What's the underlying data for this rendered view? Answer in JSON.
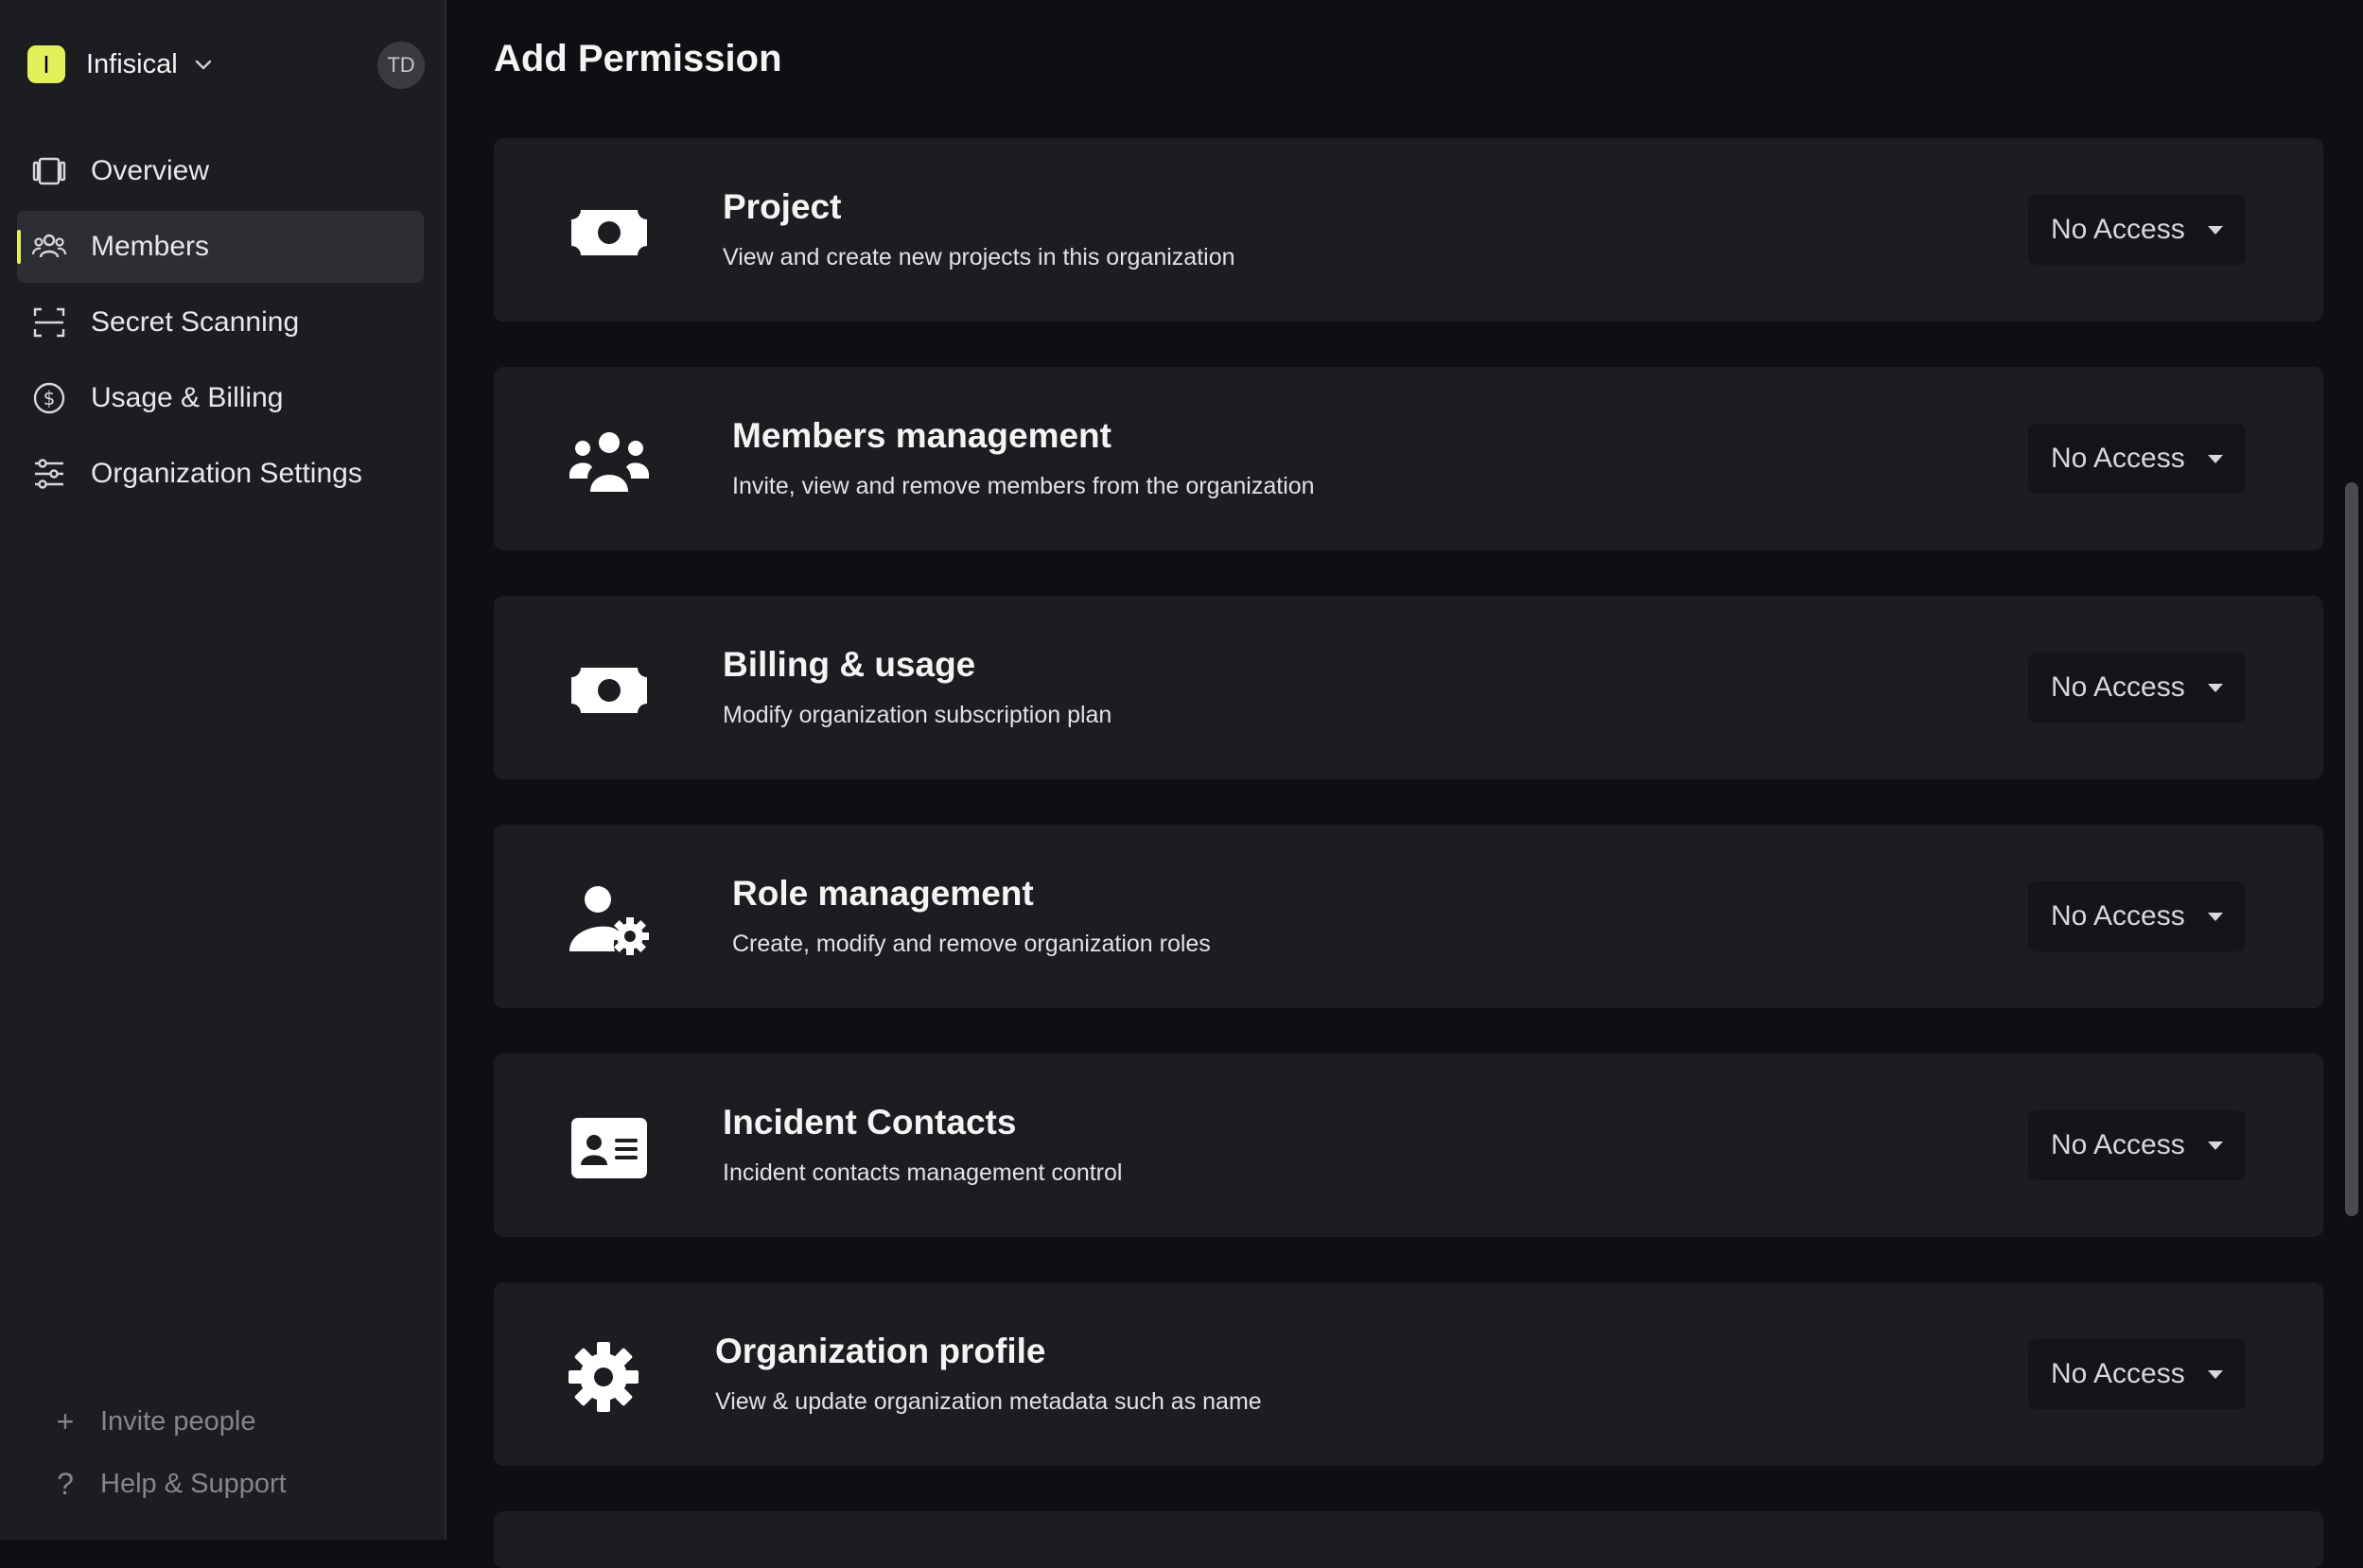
{
  "org": {
    "initial": "I",
    "name": "Infisical",
    "user_initials": "TD"
  },
  "sidebar": {
    "items": [
      {
        "label": "Overview",
        "icon": "overview-icon",
        "active": false
      },
      {
        "label": "Members",
        "icon": "members-icon",
        "active": true
      },
      {
        "label": "Secret Scanning",
        "icon": "scan-icon",
        "active": false
      },
      {
        "label": "Usage & Billing",
        "icon": "dollar-circle-icon",
        "active": false
      },
      {
        "label": "Organization Settings",
        "icon": "sliders-icon",
        "active": false
      }
    ],
    "bottom": [
      {
        "label": "Invite people",
        "icon": "plus-icon"
      },
      {
        "label": "Help & Support",
        "icon": "question-icon"
      }
    ]
  },
  "main": {
    "title": "Add Permission",
    "permissions": [
      {
        "title": "Project",
        "description": "View and create new projects in this organization",
        "icon": "money-bill-icon",
        "access": "No Access"
      },
      {
        "title": "Members management",
        "description": "Invite, view and remove members from the organization",
        "icon": "users-icon",
        "access": "No Access"
      },
      {
        "title": "Billing & usage",
        "description": "Modify organization subscription plan",
        "icon": "money-bill-icon",
        "access": "No Access"
      },
      {
        "title": "Role management",
        "description": "Create, modify and remove organization roles",
        "icon": "user-gear-icon",
        "access": "No Access"
      },
      {
        "title": "Incident Contacts",
        "description": "Incident contacts management control",
        "icon": "contact-card-icon",
        "access": "No Access"
      },
      {
        "title": "Organization profile",
        "description": "View & update organization metadata such as name",
        "icon": "gear-icon",
        "access": "No Access"
      }
    ]
  },
  "colors": {
    "accent": "#e2f05a",
    "background": "#0e0f12",
    "card": "#1c1d21"
  }
}
